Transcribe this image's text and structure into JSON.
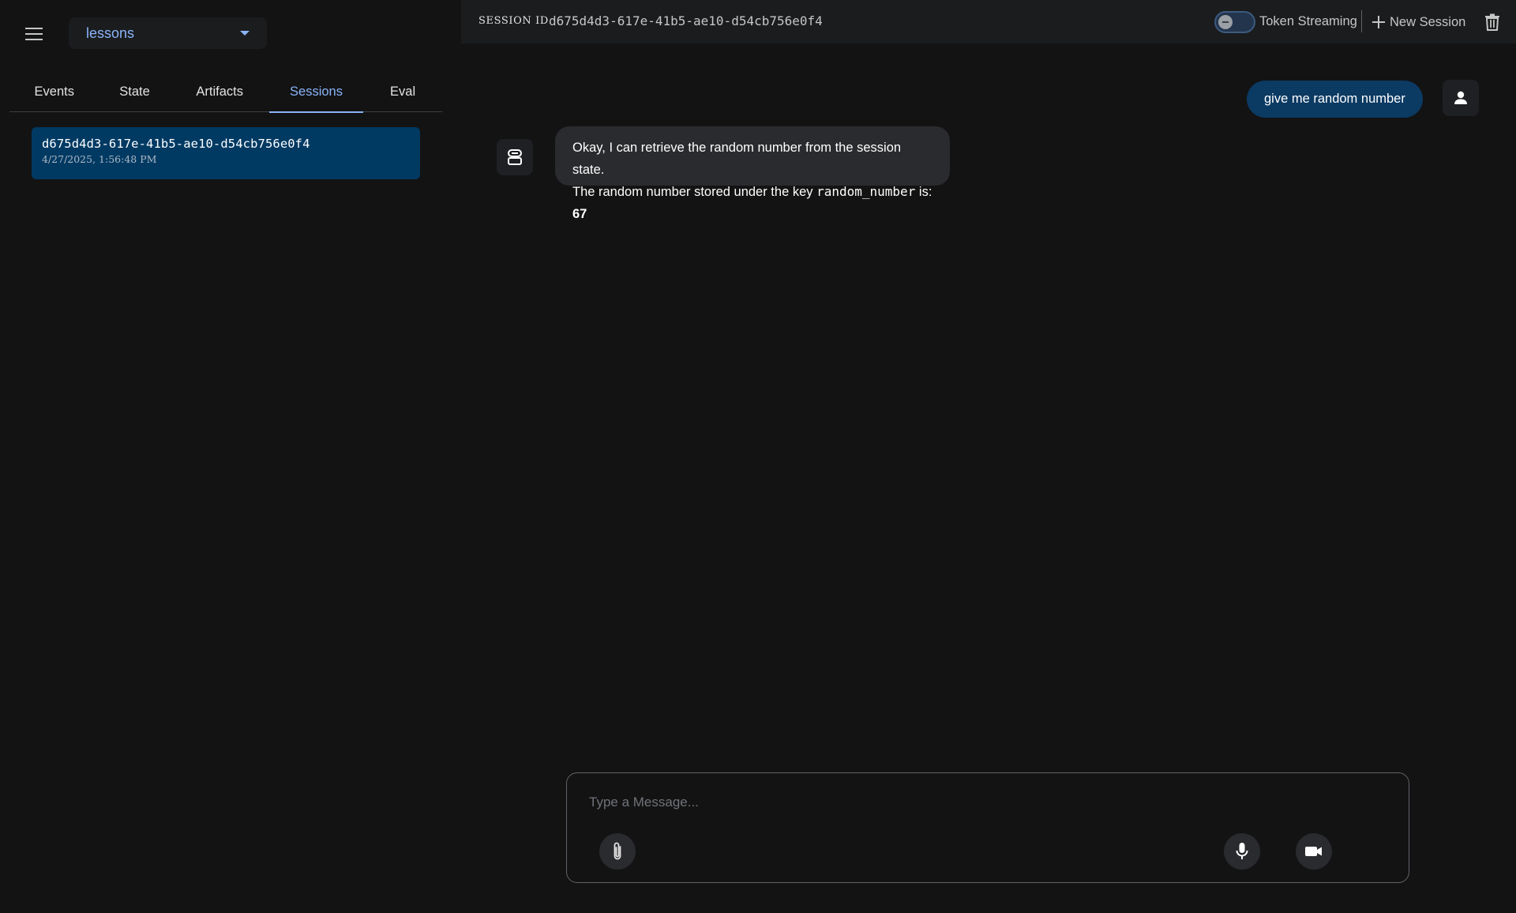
{
  "sidebar": {
    "app_select": {
      "value": "lessons"
    },
    "tabs": [
      {
        "label": "Events"
      },
      {
        "label": "State"
      },
      {
        "label": "Artifacts"
      },
      {
        "label": "Sessions",
        "active": true
      },
      {
        "label": "Eval"
      }
    ],
    "sessions": [
      {
        "id": "d675d4d3-617e-41b5-ae10-d54cb756e0f4",
        "date": "4/27/2025, 1:56:48 PM"
      }
    ]
  },
  "header": {
    "session_label": "SESSION ID",
    "session_id": "d675d4d3-617e-41b5-ae10-d54cb756e0f4",
    "toggle_label": "Token Streaming",
    "new_session_label": "New Session"
  },
  "chat": {
    "user_message": "give me random number",
    "bot_line1": "Okay, I can retrieve the random number from the session state.",
    "bot_line2_pre": "The random number stored under the key ",
    "bot_line2_code": "random_number",
    "bot_line2_mid": " is: ",
    "bot_line2_value": "67"
  },
  "composer": {
    "placeholder": "Type a Message..."
  },
  "colors": {
    "accent": "#8ab4f8",
    "selected_session_bg": "#003a63",
    "user_bubble_bg": "#0b3a63",
    "bot_bubble_bg": "#2a2b2e"
  },
  "icons": [
    "menu-icon",
    "dropdown-caret-icon",
    "plus-icon",
    "trash-icon",
    "person-icon",
    "bot-icon",
    "attach-icon",
    "mic-icon",
    "videocam-icon"
  ]
}
